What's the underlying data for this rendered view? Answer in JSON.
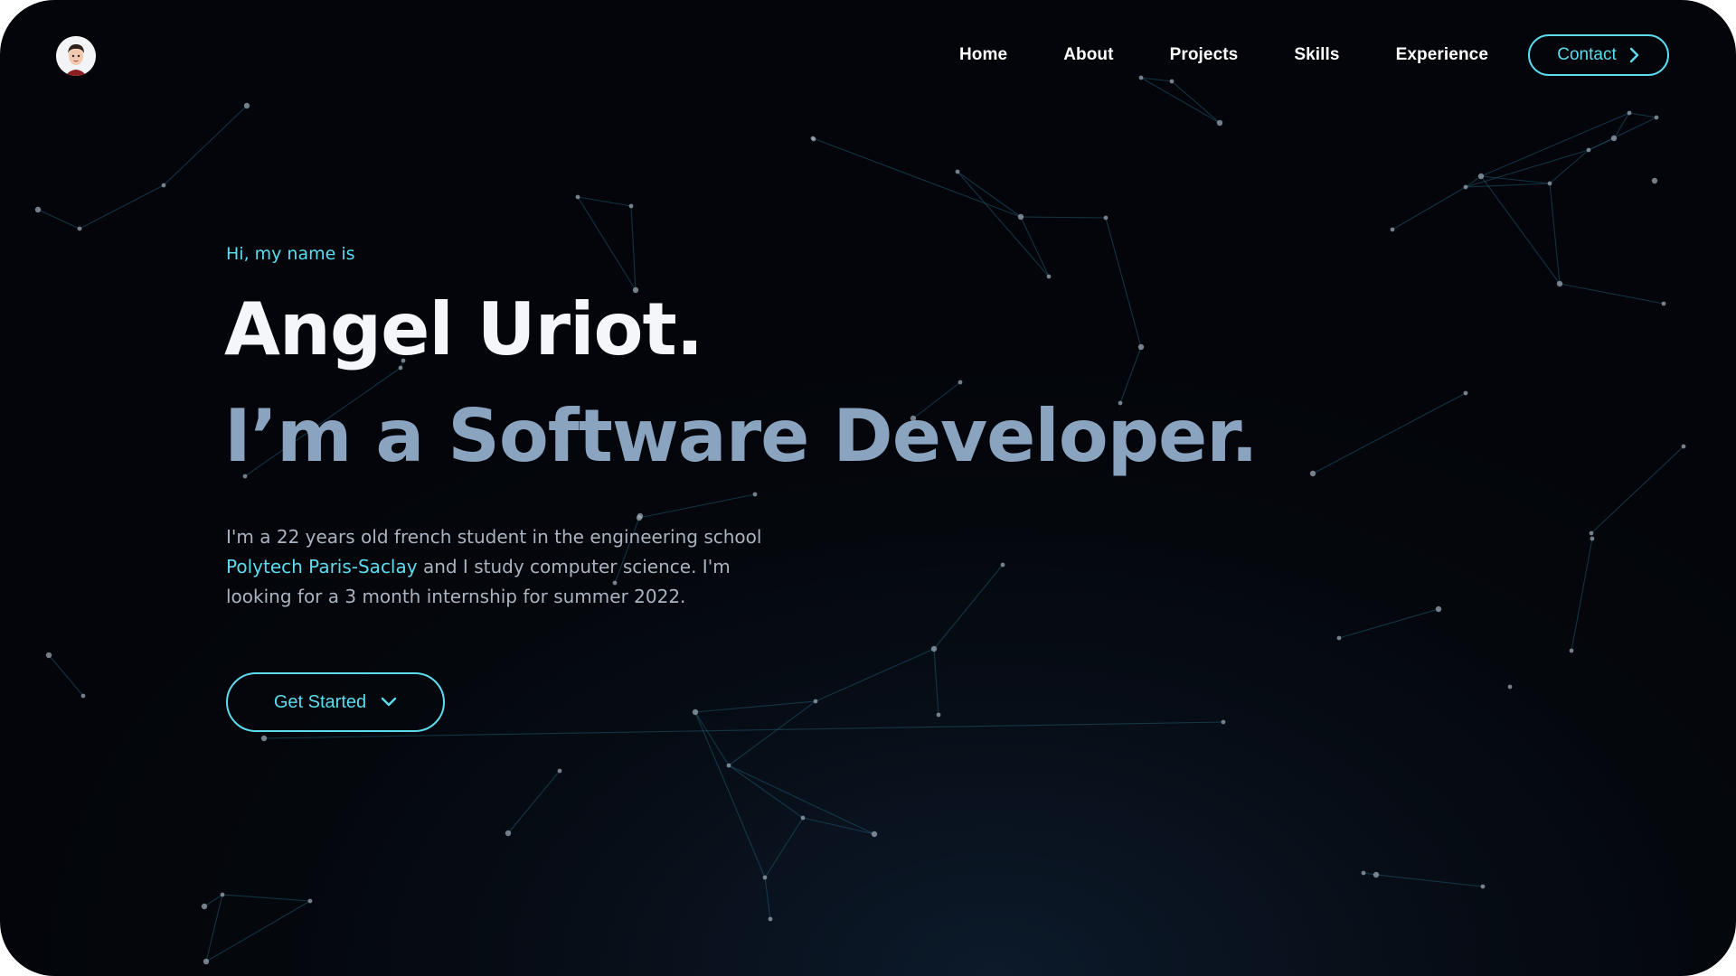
{
  "nav": {
    "links": [
      "Home",
      "About",
      "Projects",
      "Skills",
      "Experience"
    ],
    "contact_label": "Contact"
  },
  "hero": {
    "greeting": "Hi, my name is",
    "name": "Angel Uriot.",
    "role": "I’m a Software Developer.",
    "bio_part1": "I'm a 22 years old french student in the engineering school ",
    "bio_link": "Polytech Paris-Saclay",
    "bio_part2": " and I study computer science. I'm looking for a 3 month internship for summer 2022.",
    "cta_label": "Get Started"
  },
  "icons": {
    "logo": "avatar-icon",
    "contact": "chevron-right-icon",
    "cta": "chevron-down-icon"
  },
  "colors": {
    "accent": "#5ddcf0",
    "heading": "#f4f6fa",
    "subheading": "#8aa3bf",
    "body_text": "#aab3c0",
    "background": "#03050a"
  }
}
